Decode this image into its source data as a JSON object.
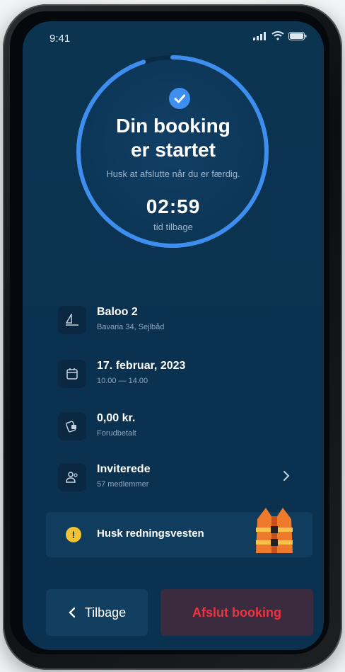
{
  "status_bar": {
    "time": "9:41"
  },
  "booking": {
    "title_line1": "Din booking",
    "title_line2": "er startet",
    "subtitle": "Husk at afslutte når du er færdig.",
    "timer": "02:59",
    "timer_label": "tid tilbage",
    "progress_remaining_fraction": 0.95
  },
  "details": [
    {
      "icon": "boat-icon",
      "title": "Baloo 2",
      "sub": "Bavaria 34, Sejlbåd"
    },
    {
      "icon": "calendar-icon",
      "title": "17. februar, 2023",
      "sub": "10.00 — 14.00"
    },
    {
      "icon": "payment-icon",
      "title": "0,00 kr.",
      "sub": "Forudbetalt"
    },
    {
      "icon": "people-icon",
      "title": "Inviterede",
      "sub": "57 medlemmer"
    }
  ],
  "banner": {
    "icon": "warning-icon",
    "text": "Husk redningsvesten",
    "image": "life-vest-illustration"
  },
  "actions": {
    "back_label": "Tilbage",
    "end_label": "Afslut booking"
  },
  "colors": {
    "background": "#0b3352",
    "ring": "#3e8ef0",
    "danger": "#ef3340",
    "warning": "#f1c232"
  }
}
